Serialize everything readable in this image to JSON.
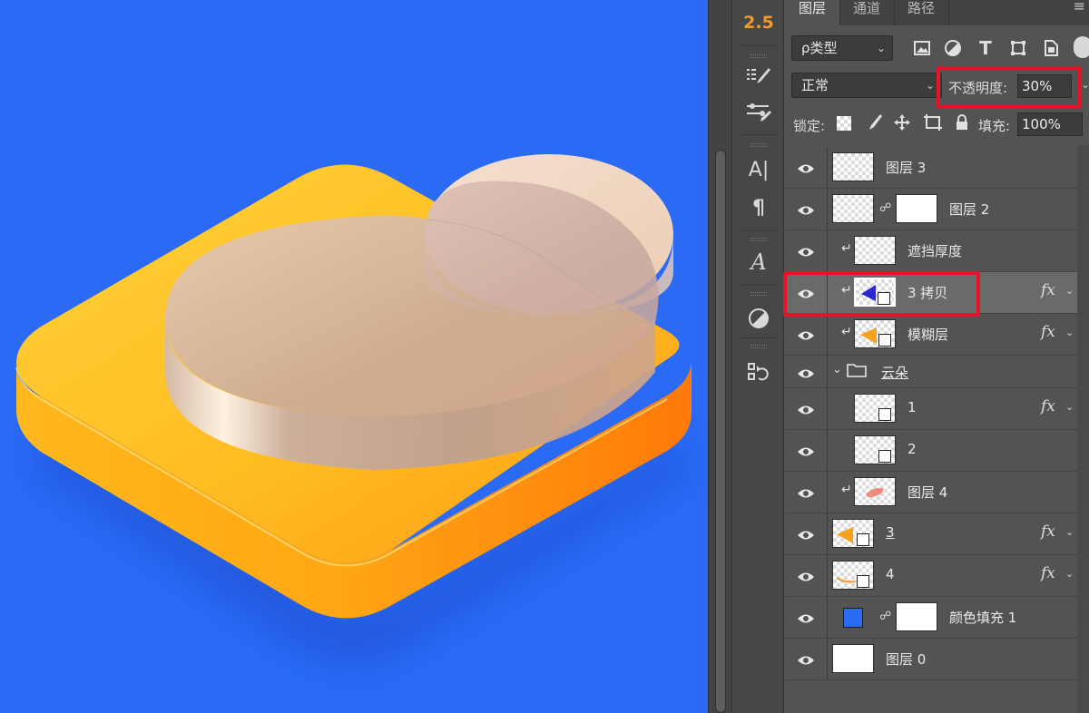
{
  "toolbar": {
    "zoom_readout": "2.5",
    "tools": [
      "brush-preset-icon",
      "brush-settings-icon",
      "character-icon",
      "paragraph-icon",
      "glyphs-icon",
      "adjustments-icon",
      "history-icon"
    ],
    "character_glyph": "A|",
    "paragraph_glyph": "¶",
    "glyph_glyph": "A"
  },
  "panel": {
    "tabs": [
      {
        "label": "图层",
        "active": true
      },
      {
        "label": "通道",
        "active": false
      },
      {
        "label": "路径",
        "active": false
      }
    ],
    "filter": {
      "label": "ρ类型"
    },
    "blend_mode": "正常",
    "opacity_label": "不透明度:",
    "opacity_value": "30%",
    "lock_label": "锁定:",
    "fill_label": "填充:",
    "fill_value": "100%",
    "highlight_color": "#e5142a"
  },
  "layers": [
    {
      "name": "图层 3",
      "thumb": "checker",
      "clip": false,
      "fx": false
    },
    {
      "name": "图层 2",
      "thumb": "checker",
      "mask": true,
      "clip": false,
      "fx": false
    },
    {
      "name": "遮挡厚度",
      "thumb": "checker",
      "clip": true,
      "fx": false
    },
    {
      "name": "3 拷贝",
      "thumb": "blue-shape",
      "clip": true,
      "fx": true,
      "selected": true
    },
    {
      "name": "模糊层",
      "thumb": "orange-shape",
      "clip": true,
      "fx": true
    },
    {
      "name": "云朵",
      "group": true,
      "expanded": true
    },
    {
      "name": "1",
      "thumb": "checker",
      "fx": true
    },
    {
      "name": "2",
      "thumb": "checker",
      "fx": false
    },
    {
      "name": "图层 4",
      "thumb": "red-smudge",
      "clip": true,
      "fx": false
    },
    {
      "name": "3",
      "thumb": "orange-shape",
      "fx": true
    },
    {
      "name": "4",
      "thumb": "orange-curve",
      "fx": true
    },
    {
      "name": "颜色填充 1",
      "thumb": "fill",
      "fill_color": "#2a6af5",
      "mask": true,
      "fx": false
    },
    {
      "name": "图层 0",
      "thumb": "white",
      "fx": false
    }
  ],
  "colors": {
    "canvas_bg": "#2a6af5",
    "accent_orange": "#f39a2c"
  }
}
